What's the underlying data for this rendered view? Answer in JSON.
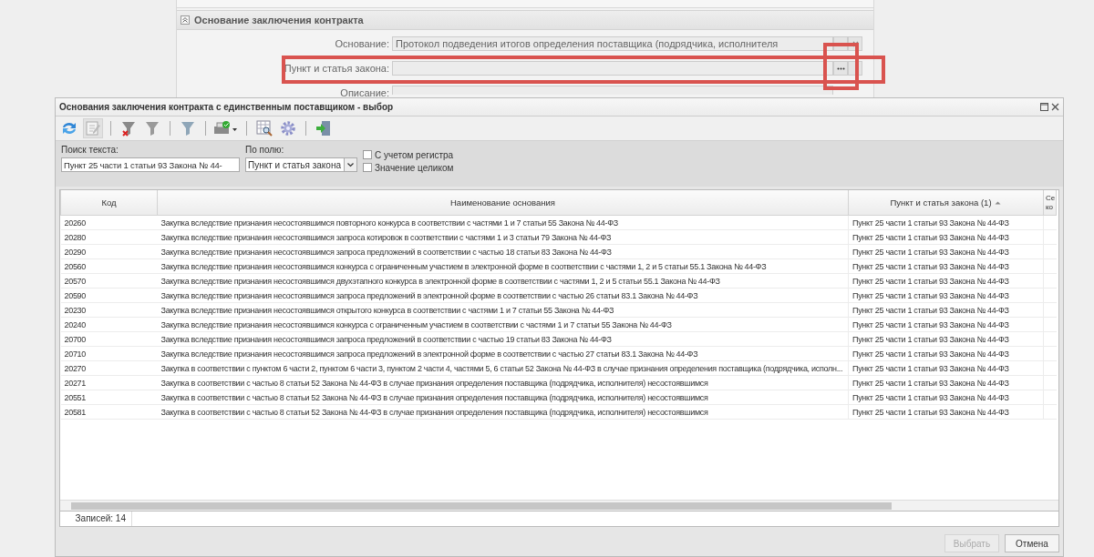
{
  "background_form": {
    "section_title": "Основание заключения контракта",
    "fields": [
      {
        "label": "Основание:",
        "value": "Протокол подведения итогов определения поставщика (подрядчика, исполнителя",
        "kind": "lookup"
      },
      {
        "label": "Пункт и статья закона:",
        "kind": "lookup",
        "highlighted": true
      },
      {
        "label": "Описание:",
        "kind": "text"
      }
    ]
  },
  "dialog": {
    "title": "Основания заключения контракта с единственным поставщиком - выбор",
    "search": {
      "label": "Поиск текста:",
      "value": "Пункт 25 части 1 статьи 93 Закона № 44-"
    },
    "field_select": {
      "label": "По полю:",
      "value": "Пункт и статья закона"
    },
    "options": [
      {
        "label": "С учетом регистра",
        "checked": false
      },
      {
        "label": "Значение целиком",
        "checked": false
      }
    ],
    "table": {
      "columns": [
        {
          "label": "Код",
          "sorted": false
        },
        {
          "label": "Наименование основания",
          "sorted": false
        },
        {
          "label": "Пункт и статья закона (1)",
          "sorted": true
        },
        {
          "label": "Се ко",
          "sorted": false
        }
      ],
      "rows": [
        {
          "code": "20260",
          "name": "Закупка вследствие признания несостоявшимся повторного конкурса в соответствии с частями 1 и 7 статьи 55 Закона № 44-ФЗ",
          "article": "Пункт 25 части 1 статьи 93 Закона № 44-ФЗ"
        },
        {
          "code": "20280",
          "name": "Закупка вследствие признания несостоявшимся запроса котировок в соответствии с частями 1 и 3 статьи 79 Закона № 44-ФЗ",
          "article": "Пункт 25 части 1 статьи 93 Закона № 44-ФЗ"
        },
        {
          "code": "20290",
          "name": "Закупка вследствие признания несостоявшимся запроса предложений в соответствии с частью 18 статьи 83 Закона № 44-ФЗ",
          "article": "Пункт 25 части 1 статьи 93 Закона № 44-ФЗ"
        },
        {
          "code": "20560",
          "name": "Закупка вследствие признания несостоявшимся конкурса с ограниченным участием в электронной форме в соответствии с частями 1, 2 и 5 статьи 55.1 Закона № 44-ФЗ",
          "article": "Пункт 25 части 1 статьи 93 Закона № 44-ФЗ"
        },
        {
          "code": "20570",
          "name": "Закупка вследствие признания несостоявшимся двухэтапного конкурса в электронной форме в соответствии с частями 1, 2 и 5 статьи 55.1 Закона № 44-ФЗ",
          "article": "Пункт 25 части 1 статьи 93 Закона № 44-ФЗ"
        },
        {
          "code": "20590",
          "name": "Закупка вследствие признания несостоявшимся запроса предложений в электронной форме в соответствии с частью 26 статьи 83.1 Закона № 44-ФЗ",
          "article": "Пункт 25 части 1 статьи 93 Закона № 44-ФЗ"
        },
        {
          "code": "20230",
          "name": "Закупка вследствие признания несостоявшимся открытого конкурса в соответствии с частями 1 и 7 статьи 55    Закона № 44-ФЗ",
          "article": "Пункт 25 части 1 статьи 93 Закона № 44-ФЗ"
        },
        {
          "code": "20240",
          "name": "Закупка вследствие признания несостоявшимся конкурса с ограниченным участием в соответствии с частями 1 и 7 статьи 55 Закона № 44-ФЗ",
          "article": "Пункт 25 части 1 статьи 93 Закона № 44-ФЗ"
        },
        {
          "code": "20700",
          "name": "Закупка вследствие признания несостоявшимся запроса предложений в соответствии с частью 19 статьи 83 Закона № 44-ФЗ",
          "article": "Пункт 25 части 1 статьи 93 Закона № 44-ФЗ"
        },
        {
          "code": "20710",
          "name": "Закупка вследствие признания несостоявшимся запроса предложений в электронной форме в соответствии с частью 27 статьи 83.1 Закона № 44-ФЗ",
          "article": "Пункт 25 части 1 статьи 93 Закона № 44-ФЗ"
        },
        {
          "code": "20270",
          "name": "Закупка в соответствии с пунктом 6 части 2, пунктом 6 части 3, пунктом 2 части 4, частями 5, 6 статьи 52 Закона № 44-ФЗ в случае признания определения поставщика (подрядчика, исполн...",
          "article": "Пункт 25 части 1 статьи 93 Закона № 44-ФЗ"
        },
        {
          "code": "20271",
          "name": "Закупка в соответствии с частью 8 статьи 52 Закона № 44-ФЗ в случае признания определения поставщика (подрядчика, исполнителя) несостоявшимся",
          "article": "Пункт 25 части 1 статьи 93 Закона № 44-ФЗ"
        },
        {
          "code": "20551",
          "name": "Закупка в соответствии с частью 8 статьи 52 Закона № 44-ФЗ в случае признания определения поставщика (подрядчика, исполнителя) несостоявшимся",
          "article": "Пункт 25 части 1 статьи 93 Закона № 44-ФЗ"
        },
        {
          "code": "20581",
          "name": "Закупка в соответствии с частью 8 статьи 52 Закона № 44-ФЗ в случае признания определения поставщика (подрядчика, исполнителя) несостоявшимся",
          "article": "Пункт 25 части 1 статьи 93 Закона № 44-ФЗ"
        }
      ]
    },
    "records": "Записей: 14",
    "buttons": [
      {
        "label": "Выбрать",
        "disabled": true
      },
      {
        "label": "Отмена",
        "disabled": false
      }
    ]
  }
}
